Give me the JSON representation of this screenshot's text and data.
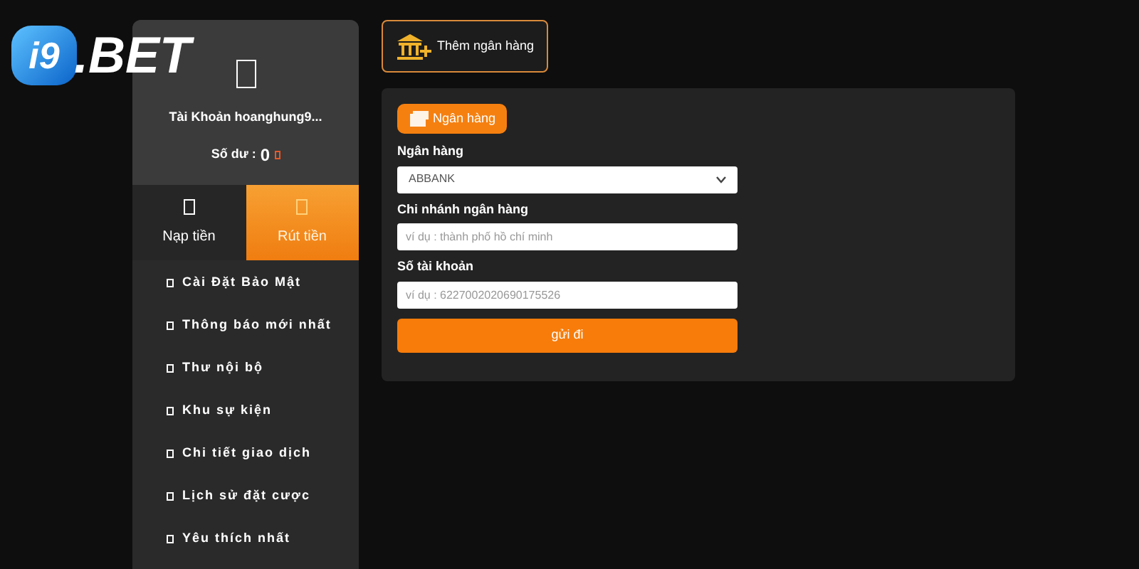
{
  "logo": {
    "mark": "i9",
    "text": ".BET"
  },
  "account": {
    "name": "Tài Khoản hoanghung9...",
    "balance_label": "Số dư :",
    "balance": "0"
  },
  "actions": [
    {
      "label": "Nạp tiền",
      "selected": false
    },
    {
      "label": "Rút tiền",
      "selected": true
    }
  ],
  "menu": [
    "Cài Đặt Bảo Mật",
    "Thông báo mới nhất",
    "Thư nội bộ",
    "Khu sự kiện",
    "Chi tiết giao dịch",
    "Lịch sử đặt cược",
    "Yêu thích nhất"
  ],
  "add_bank_button": "Thêm ngân hàng",
  "form": {
    "tab": "Ngân hàng",
    "fields": [
      {
        "kind": "select",
        "label": "Ngân hàng",
        "value": "ABBANK"
      },
      {
        "kind": "input",
        "label": "Chi nhánh ngân hàng",
        "placeholder": "ví dụ : thành phố hồ chí minh"
      },
      {
        "kind": "input",
        "label": "Số tài khoản",
        "placeholder": "ví dụ : 6227002020690175526"
      }
    ],
    "submit": "gửi đi"
  }
}
